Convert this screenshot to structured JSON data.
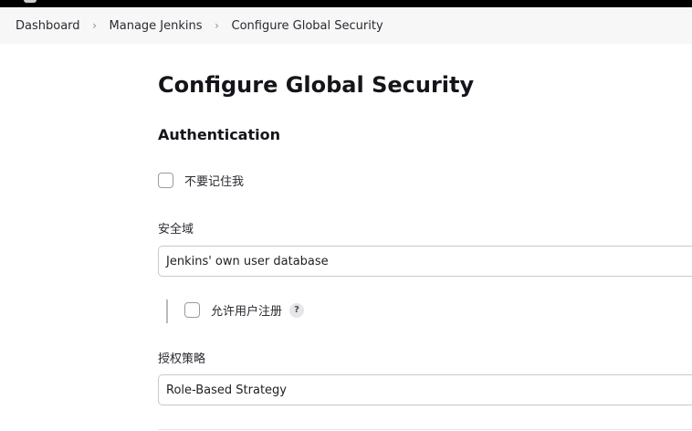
{
  "breadcrumb": {
    "items": [
      "Dashboard",
      "Manage Jenkins",
      "Configure Global Security"
    ],
    "separator": "›"
  },
  "page": {
    "title": "Configure Global Security"
  },
  "authentication": {
    "section_title": "Authentication",
    "remember_me_label": "不要记住我",
    "remember_me_checked": false,
    "security_realm_label": "安全域",
    "security_realm_value": "Jenkins' own user database",
    "allow_signup_label": "允许用户注册",
    "allow_signup_checked": false,
    "help_glyph": "?",
    "authorization_label": "授权策略",
    "authorization_value": "Role-Based Strategy"
  },
  "icons": {
    "breadcrumb_separator": "chevron-right-icon",
    "help": "help-icon"
  }
}
